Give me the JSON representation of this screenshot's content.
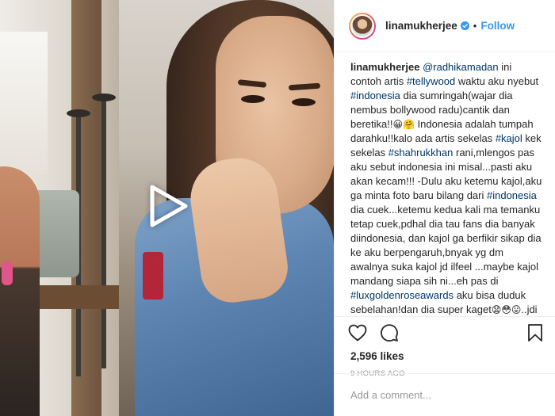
{
  "post": {
    "username": "linamukherjee",
    "follow_label": "Follow",
    "dot": "•",
    "caption": {
      "username": "linamukherjee",
      "mention": "@radhikamadan",
      "t1": " ini contoh artis ",
      "tag_tellywood": "#tellywood",
      "t2": " waktu aku nyebut ",
      "tag_indonesia1": "#indonesia",
      "t3": " dia sumringah(wajar dia nembus bollywood radu)cantik dan beretika!!",
      "emoji1": "😀🤗",
      "t4": " Indonesia adalah tumpah darahku!!kalo ada artis sekelas ",
      "tag_kajol": "#kajol",
      "t5": " kek sekelas ",
      "tag_shahrukhkhan": "#shahrukkhan",
      "t6": " rani,mlengos pas aku sebut indonesia ini misal...pasti aku akan kecam!!! -Dulu aku ketemu kajol,aku ga minta foto baru bilang dari ",
      "tag_indonesia2": "#indonesia",
      "t7": " dia cuek...ketemu kedua kali ma temanku tetap cuek,pdhal dia tau fans dia banyak diindonesia, dan kajol ga berfikir sikap dia ke aku berpengaruh,bnyak yg dm awalnya suka kajol jd ilfeel ...maybe kajol mandang siapa sih ni...eh pas di ",
      "tag_luxgoldenroseawards": "#luxgoldenroseawards",
      "t8": " aku bisa duduk sebelahan!dan dia super kaget",
      "emoji2": "😧😳😛",
      "t9": "..jdi gua bukan sakit hati ga dpt foto tp dengar fans dri jauh cueknya ga menghargai itu gue ga demen!!! Docent means i hate her"
    },
    "likes": "2,596 likes",
    "time": "9 HOURS AGO",
    "comment_placeholder": "Add a comment..."
  },
  "icons": {
    "verified": "verified-badge-icon",
    "play": "play-icon",
    "heart": "heart-icon",
    "comment": "comment-icon",
    "bookmark": "bookmark-icon"
  },
  "colors": {
    "accent": "#3897f0",
    "link": "#003569",
    "text": "#262626",
    "muted": "#999999"
  }
}
